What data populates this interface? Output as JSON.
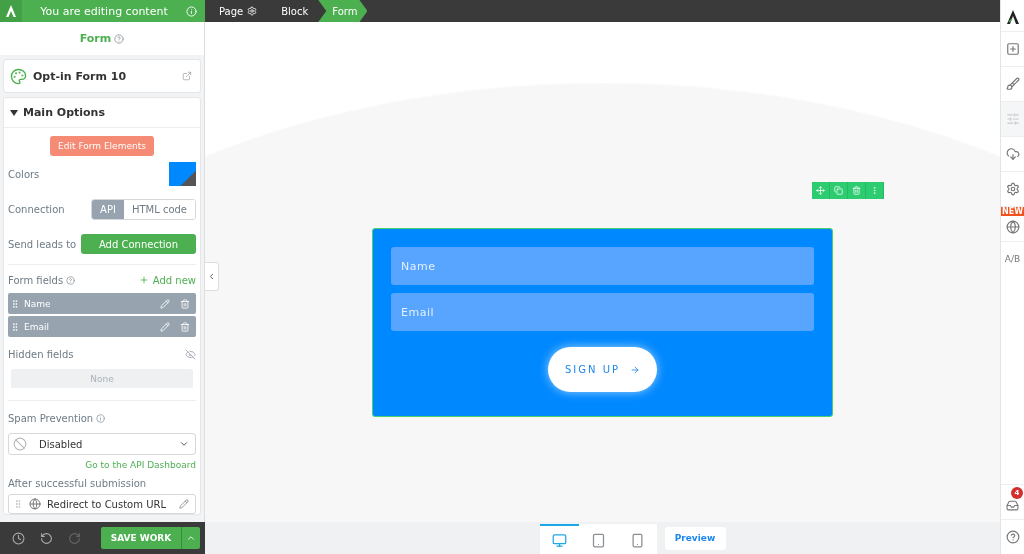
{
  "status_banner": {
    "text": "You are editing content"
  },
  "breadcrumbs": [
    {
      "label": "Page",
      "selected": false
    },
    {
      "label": "Block",
      "selected": false
    },
    {
      "label": "Form",
      "selected": true
    }
  ],
  "panel": {
    "title": "Form",
    "element_name": "Opt-in Form 10",
    "section": {
      "title": "Main Options",
      "expanded": true
    },
    "edit_button": "Edit Form Elements",
    "colors_label": "Colors",
    "connection": {
      "label": "Connection",
      "options": [
        {
          "label": "API",
          "selected": true
        },
        {
          "label": "HTML code",
          "selected": false
        }
      ]
    },
    "send_leads": {
      "label": "Send leads to",
      "button": "Add Connection"
    },
    "form_fields": {
      "label": "Form fields",
      "add": "Add new",
      "items": [
        "Name",
        "Email"
      ]
    },
    "hidden_fields": {
      "label": "Hidden fields",
      "empty": "None"
    },
    "spam": {
      "label": "Spam Prevention",
      "value": "Disabled",
      "link": "Go to the API Dashboard"
    },
    "after_submit": {
      "label": "After successful submission",
      "action": "Redirect to Custom URL"
    }
  },
  "footer": {
    "save": "SAVE WORK"
  },
  "form_preview": {
    "fields": [
      {
        "placeholder": "Name"
      },
      {
        "placeholder": "Email"
      }
    ],
    "button": "SIGN UP"
  },
  "devices": [
    {
      "kind": "desktop",
      "selected": true
    },
    {
      "kind": "tablet",
      "selected": false
    },
    {
      "kind": "mobile",
      "selected": false
    }
  ],
  "preview_button": "Preview",
  "right_toolbar": {
    "new_badge": "NEW",
    "ab_label": "A/B",
    "notification_count": "4"
  }
}
